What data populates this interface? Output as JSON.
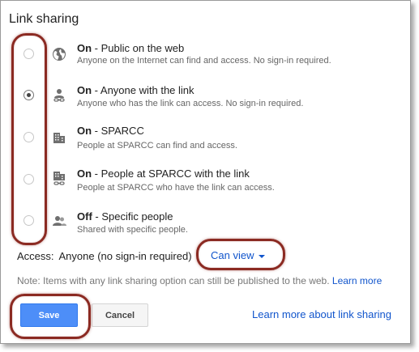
{
  "dialog": {
    "title": "Link sharing"
  },
  "options": [
    {
      "title_bold": "On",
      "title_rest": " - Public on the web",
      "desc": "Anyone on the Internet can find and access. No sign-in required.",
      "icon": "globe-icon",
      "selected": false
    },
    {
      "title_bold": "On",
      "title_rest": " - Anyone with the link",
      "desc": "Anyone who has the link can access. No sign-in required.",
      "icon": "person-link-icon",
      "selected": true
    },
    {
      "title_bold": "On",
      "title_rest": " - SPARCC",
      "desc": "People at SPARCC can find and access.",
      "icon": "building-icon",
      "selected": false
    },
    {
      "title_bold": "On",
      "title_rest": " - People at SPARCC with the link",
      "desc": "People at SPARCC who have the link can access.",
      "icon": "building-link-icon",
      "selected": false
    },
    {
      "title_bold": "Off",
      "title_rest": " - Specific people",
      "desc": "Shared with specific people.",
      "icon": "people-icon",
      "selected": false
    }
  ],
  "access": {
    "label": "Access:",
    "value": "Anyone (no sign-in required)",
    "dropdown": "Can view"
  },
  "note": {
    "text": "Note: Items with any link sharing option can still be published to the web.",
    "link": "Learn more"
  },
  "buttons": {
    "save": "Save",
    "cancel": "Cancel"
  },
  "footer_link": "Learn more about link sharing",
  "colors": {
    "accent": "#4d8ef8",
    "link": "#1155cc",
    "annotation": "#8b2a22"
  }
}
